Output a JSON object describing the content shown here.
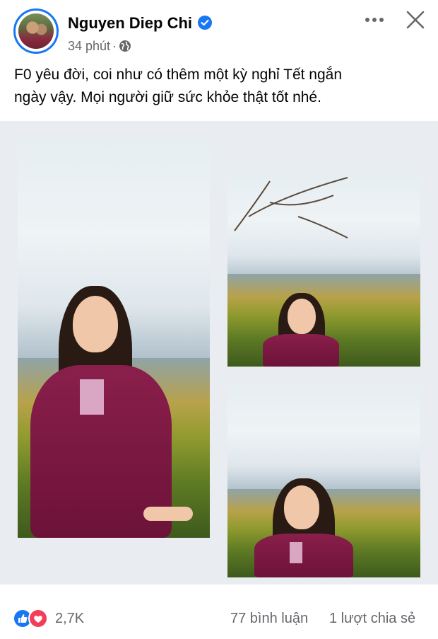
{
  "post": {
    "author": "Nguyen Diep Chi",
    "time": "34 phút",
    "separator": "·",
    "text_line1": "F0 yêu đời, coi như có thêm một kỳ nghỉ Tết ngắn",
    "text_line2": "ngày vậy. Mọi người giữ sức khỏe thật tốt nhé."
  },
  "icons": {
    "verified": "verified-badge-icon",
    "privacy": "globe-icon",
    "more": "more-options-icon",
    "close": "close-icon",
    "like": "like-reaction-icon",
    "love": "love-reaction-icon"
  },
  "photos": [
    {
      "alt": "photo-1"
    },
    {
      "alt": "photo-2"
    },
    {
      "alt": "photo-3"
    }
  ],
  "footer": {
    "reaction_count": "2,7K",
    "comments": "77 bình luận",
    "shares": "1 lượt chia sẻ"
  },
  "colors": {
    "brand_blue": "#1877f2",
    "love_red": "#f33e58",
    "secondary_text": "#65676b",
    "photo_background": "#e9edf2"
  }
}
